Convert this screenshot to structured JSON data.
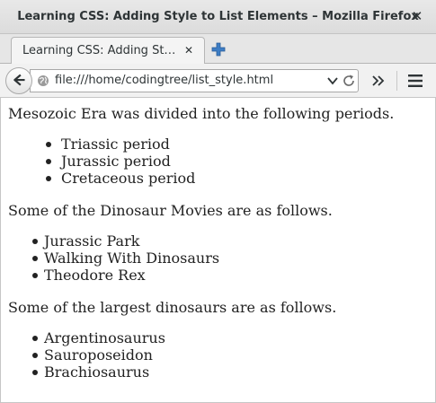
{
  "window": {
    "title": "Learning CSS: Adding Style to List Elements – Mozilla Firefox",
    "close_glyph": "✕"
  },
  "tabs": [
    {
      "label": "Learning CSS: Adding St…",
      "close_glyph": "✕",
      "active": true
    }
  ],
  "navbar": {
    "url": "file:///home/codingtree/list_style.html",
    "icons": [
      "back-arrow-icon",
      "site-identity-icon",
      "url-dropdown-icon",
      "reload-icon",
      "overflow-chevron-icon",
      "hamburger-menu-icon",
      "new-tab-plus-icon"
    ]
  },
  "page": {
    "sections": [
      {
        "intro": "Mesozoic Era was divided into the following periods.",
        "items": [
          "Triassic period",
          "Jurassic period",
          "Cretaceous period"
        ]
      },
      {
        "intro": "Some of the Dinosaur Movies are as follows.",
        "items": [
          "Jurassic Park",
          "Walking With Dinosaurs",
          "Theodore Rex"
        ]
      },
      {
        "intro": "Some of the largest dinosaurs are as follows.",
        "items": [
          "Argentinosaurus",
          "Sauroposeidon",
          "Brachiosaurus"
        ]
      }
    ]
  },
  "colors": {
    "chrome_bg": "#e6e6e6",
    "text": "#222222",
    "accent_plus": "#3d7dc4"
  }
}
